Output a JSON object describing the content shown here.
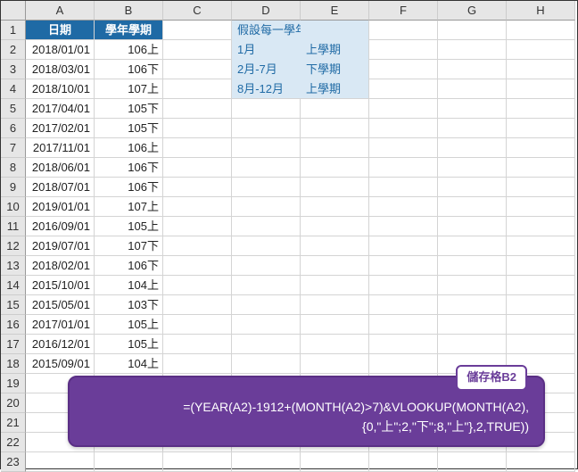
{
  "columns": [
    "A",
    "B",
    "C",
    "D",
    "E",
    "F",
    "G",
    "H"
  ],
  "rowCount": 23,
  "headers": {
    "a1": "日期",
    "b1": "學年學期"
  },
  "rows": [
    {
      "date": "2018/01/01",
      "term": "106上"
    },
    {
      "date": "2018/03/01",
      "term": "106下"
    },
    {
      "date": "2018/10/01",
      "term": "107上"
    },
    {
      "date": "2017/04/01",
      "term": "105下"
    },
    {
      "date": "2017/02/01",
      "term": "105下"
    },
    {
      "date": "2017/11/01",
      "term": "106上"
    },
    {
      "date": "2018/06/01",
      "term": "106下"
    },
    {
      "date": "2018/07/01",
      "term": "106下"
    },
    {
      "date": "2019/01/01",
      "term": "107上"
    },
    {
      "date": "2016/09/01",
      "term": "105上"
    },
    {
      "date": "2019/07/01",
      "term": "107下"
    },
    {
      "date": "2018/02/01",
      "term": "106下"
    },
    {
      "date": "2015/10/01",
      "term": "104上"
    },
    {
      "date": "2015/05/01",
      "term": "103下"
    },
    {
      "date": "2017/01/01",
      "term": "105上"
    },
    {
      "date": "2016/12/01",
      "term": "105上"
    },
    {
      "date": "2015/09/01",
      "term": "104上"
    }
  ],
  "note": {
    "title": "假設每一學年：",
    "r2a": "1月",
    "r2b": "上學期",
    "r3a": "2月-7月",
    "r3b": "下學期",
    "r4a": "8月-12月",
    "r4b": "上學期"
  },
  "formula": {
    "label": "儲存格B2",
    "text": "=(YEAR(A2)-1912+(MONTH(A2)>7)&VLOOKUP(MONTH(A2),{0,\"上\";2,\"下\";8,\"上\"},2,TRUE))"
  }
}
